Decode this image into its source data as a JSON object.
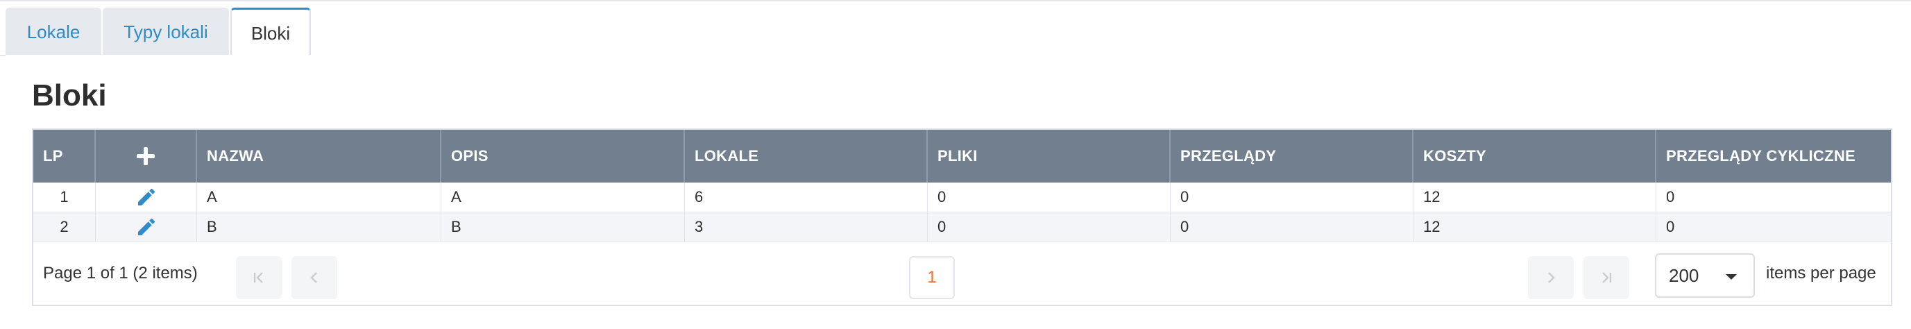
{
  "tabs": [
    {
      "label": "Lokale"
    },
    {
      "label": "Typy lokali"
    },
    {
      "label": "Bloki"
    }
  ],
  "page": {
    "title": "Bloki"
  },
  "grid": {
    "columns": [
      "LP",
      "",
      "NAZWA",
      "OPIS",
      "LOKALE",
      "PLIKI",
      "PRZEGLĄDY",
      "KOSZTY",
      "PRZEGLĄDY CYKLICZNE"
    ],
    "rows": [
      {
        "lp": "1",
        "nazwa": "A",
        "opis": "A",
        "lokale": "6",
        "pliki": "0",
        "przeglady": "0",
        "koszty": "12",
        "cykliczne": "0"
      },
      {
        "lp": "2",
        "nazwa": "B",
        "opis": "B",
        "lokale": "3",
        "pliki": "0",
        "przeglady": "0",
        "koszty": "12",
        "cykliczne": "0"
      }
    ]
  },
  "pager": {
    "info": "Page 1 of 1 (2 items)",
    "current_page": "1",
    "page_size": "200",
    "items_per_page_label": "items per page"
  },
  "icons": {
    "add": "plus-icon",
    "edit": "pencil-icon",
    "first": "first-page-icon",
    "prev": "prev-page-icon",
    "next": "next-page-icon",
    "last": "last-page-icon",
    "dropdown": "chevron-down-icon"
  },
  "colors": {
    "accent": "#2f8cc9",
    "header_bg": "#717f8f",
    "current_page": "#f06a2a"
  }
}
